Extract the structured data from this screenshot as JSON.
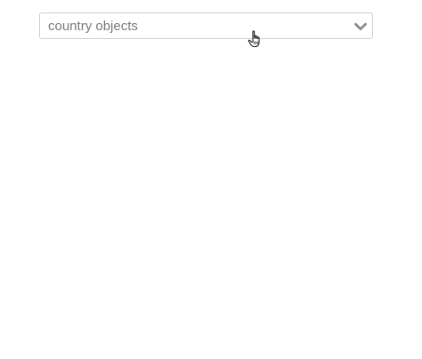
{
  "dropdown": {
    "placeholder": "country objects",
    "icon": "chevron-down-icon"
  },
  "pointer": {
    "icon": "hand-pointer-cursor-icon"
  }
}
